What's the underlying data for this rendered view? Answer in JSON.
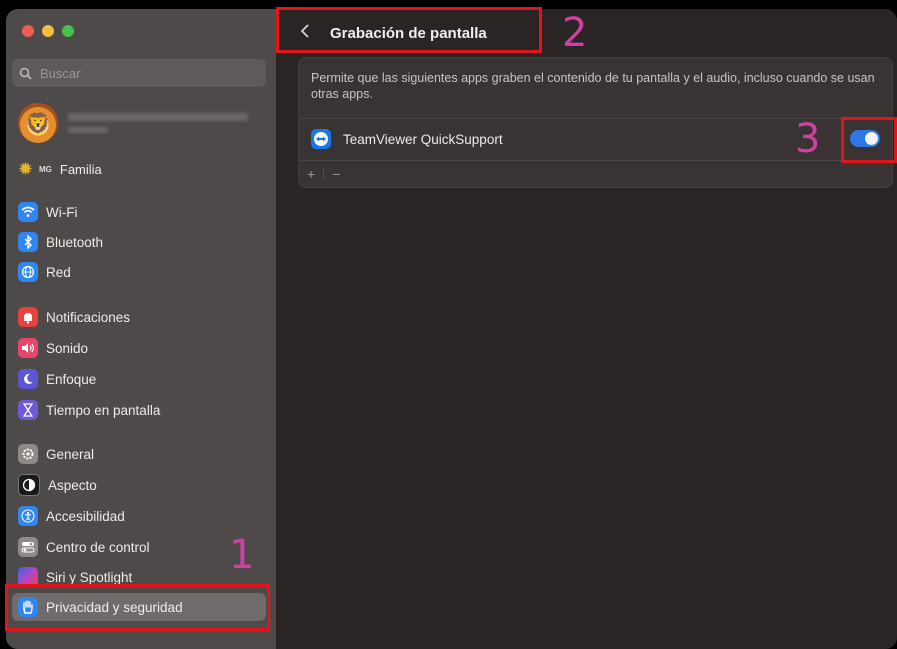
{
  "search": {
    "placeholder": "Buscar"
  },
  "family": {
    "badge": "MG",
    "label": "Familia"
  },
  "sidebar": {
    "items": [
      {
        "label": "Wi-Fi",
        "icon": "wifi-icon",
        "color": "#2f86f0"
      },
      {
        "label": "Bluetooth",
        "icon": "bluetooth-icon",
        "color": "#2f86f0"
      },
      {
        "label": "Red",
        "icon": "globe-icon",
        "color": "#2f86f0"
      },
      {
        "label": "Notificaciones",
        "icon": "bell-icon",
        "color": "#e9413f"
      },
      {
        "label": "Sonido",
        "icon": "speaker-icon",
        "color": "#e5456a"
      },
      {
        "label": "Enfoque",
        "icon": "moon-icon",
        "color": "#5c56d6"
      },
      {
        "label": "Tiempo en pantalla",
        "icon": "hourglass-icon",
        "color": "#6d5bd6"
      },
      {
        "label": "General",
        "icon": "gear-icon",
        "color": "#8e8a88"
      },
      {
        "label": "Aspecto",
        "icon": "appearance-icon",
        "color": "#1a1a1a"
      },
      {
        "label": "Accesibilidad",
        "icon": "accessibility-icon",
        "color": "#2f86f0"
      },
      {
        "label": "Centro de control",
        "icon": "control-center-icon",
        "color": "#8e8a88"
      },
      {
        "label": "Siri y Spotlight",
        "icon": "siri-icon",
        "color": "#b844c9"
      },
      {
        "label": "Privacidad y seguridad",
        "icon": "hand-icon",
        "color": "#2f86f0"
      }
    ]
  },
  "main": {
    "title": "Grabación de pantalla",
    "description": "Permite que las siguientes apps graben el contenido de tu pantalla y el audio, incluso cuando se usan otras apps.",
    "app": {
      "name": "TeamViewer QuickSupport",
      "enabled": true
    },
    "add_label": "+",
    "remove_label": "−"
  },
  "annotations": [
    "1",
    "2",
    "3"
  ],
  "colors": {
    "highlight": "#e3131b",
    "annotation_number": "#d03fa4",
    "toggle_on": "#2d78e4"
  }
}
